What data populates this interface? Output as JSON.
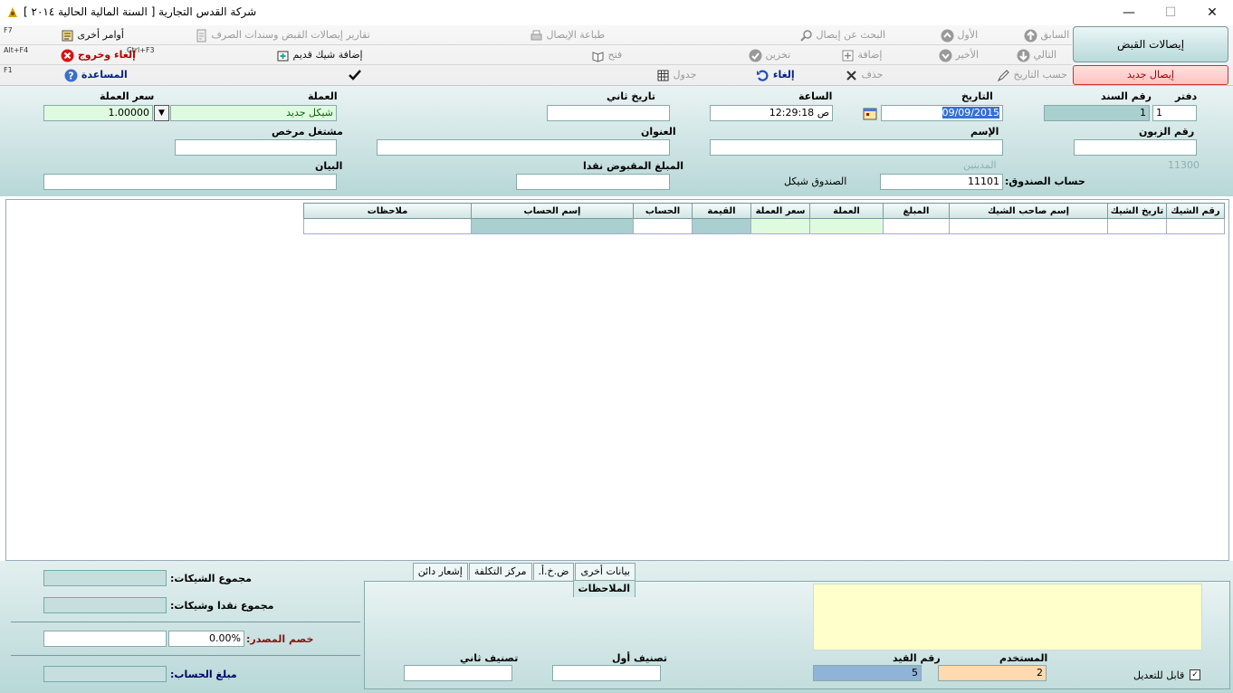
{
  "window": {
    "title": "شركة القدس التجارية [ السنة المالية الحالية ٢٠١٤ ]",
    "minimize": "—",
    "maximize": "☐",
    "close": "✕"
  },
  "toolbar": {
    "row1": {
      "previous": "السابق",
      "first": "الأول",
      "search": "البحث عن إيصال",
      "print": "طباعة الإيصال",
      "reports": "تقارير إيصالات القبض وسندات الصرف",
      "more": "أوامر أخرى",
      "more_key": "F7"
    },
    "row2": {
      "next": "التالي",
      "last": "الأخير",
      "add": "إضافة",
      "save": "تخزين",
      "open": "فتح",
      "add_old_check": "إضافة شيك قديم",
      "cancel_exit": "إلغاء وخروج",
      "add_old_check_key": "Ctrl+F3",
      "cancel_exit_key": "Alt+F4"
    },
    "row3": {
      "by_date": "حسب التاريخ",
      "delete": "حذف",
      "cancel": "إلغاء",
      "table": "جدول",
      "help": "المساعدة",
      "help_key": "F1"
    },
    "main_button": "إيصالات القبض",
    "new_button": "إيصال جديد"
  },
  "header": {
    "ledger_label": "دفتر",
    "ledger_value": "1",
    "voucher_no_label": "رقم السند",
    "voucher_no_value": "1",
    "date_label": "التاريخ",
    "date_value": "09/09/2015",
    "time_label": "الساعة",
    "time_value": "12:29:18 ص",
    "second_date_label": "تاريخ ثاني",
    "second_date_value": "",
    "currency_label": "العملة",
    "currency_value": "شيكل جديد",
    "rate_label": "سعر العملة",
    "rate_value": "1.00000",
    "customer_no_label": "رقم الزبون",
    "customer_no_value": "",
    "name_label": "الإسم",
    "name_value": "",
    "address_label": "العنوان",
    "address_value": "",
    "licensed_label": "مشتغل مرخص",
    "licensed_value": "",
    "debtors_code": "11300",
    "debtors_label": "المدينين",
    "cashbox_account_label": "حساب الصندوق:",
    "cashbox_account_value": "11101",
    "cashbox_name": "الصندوق شيكل",
    "cash_received_label": "المبلغ المقبوض نقدا",
    "cash_received_value": "",
    "statement_label": "البيان",
    "statement_value": ""
  },
  "grid": {
    "columns": [
      "رقم الشيك",
      "تاريخ الشيك",
      "إسم صاحب الشيك",
      "المبلغ",
      "العملة",
      "سعر العملة",
      "القيمة",
      "الحساب",
      "إسم الحساب",
      "ملاحظات"
    ]
  },
  "footer": {
    "total_checks_label": "مجموع الشيكات:",
    "total_checks_value": "",
    "total_cash_checks_label": "مجموع نقدا وشيكات:",
    "total_cash_checks_value": "",
    "withholding_label": "خصم المصدر:",
    "withholding_pct": "0.00%",
    "withholding_value": "",
    "account_amount_label": "مبلغ الحساب:",
    "account_amount_value": "",
    "tabs": [
      "الملاحظات",
      "إشعار دائن",
      "مركز التكلفة",
      "ض.خ.أ.",
      "بيانات أخرى"
    ],
    "user_label": "المستخدم",
    "user_value": "2",
    "entry_no_label": "رقم القيد",
    "entry_no_value": "5",
    "class1_label": "تصنيف أول",
    "class1_value": "",
    "class2_label": "تصنيف ثاني",
    "class2_value": "",
    "editable_label": "قابل للتعديل",
    "editable_check": "✓"
  }
}
